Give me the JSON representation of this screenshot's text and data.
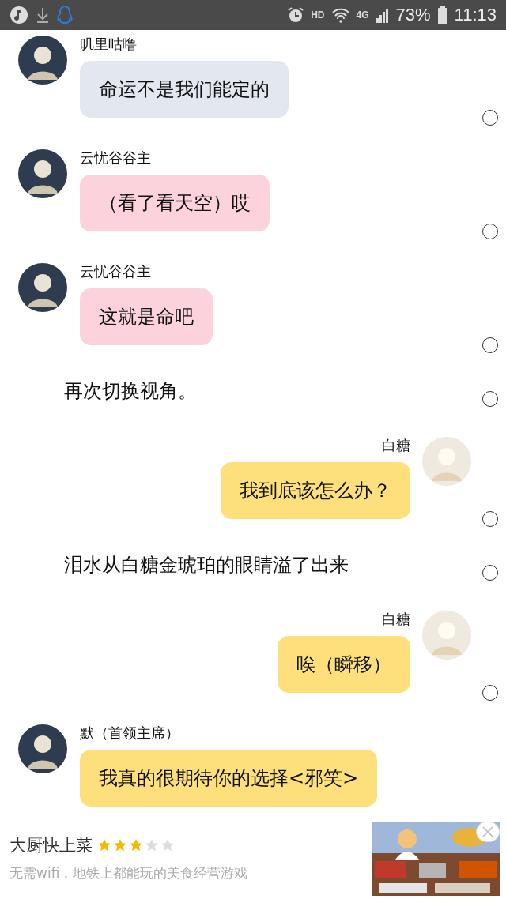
{
  "status_bar": {
    "network": "4G",
    "hd": "HD",
    "battery": "73%",
    "time": "11:13"
  },
  "messages": [
    {
      "kind": "left",
      "sender": "叽里咕噜",
      "text": "命运不是我们能定的",
      "color": "#e3e8f0",
      "selected": false
    },
    {
      "kind": "left",
      "sender": "云忧谷谷主",
      "text": "（看了看天空）哎",
      "color": "#fcd3dc",
      "selected": false
    },
    {
      "kind": "left",
      "sender": "云忧谷谷主",
      "text": "这就是命吧",
      "color": "#fcd3dc",
      "selected": false
    },
    {
      "kind": "narration",
      "text": "再次切换视角。",
      "selected": false
    },
    {
      "kind": "right",
      "sender": "白糖",
      "text": "我到底该怎么办？",
      "color": "#fde07c",
      "selected": false
    },
    {
      "kind": "narration",
      "text": "泪水从白糖金琥珀的眼睛溢了出来",
      "selected": false
    },
    {
      "kind": "right",
      "sender": "白糖",
      "text": "唉（瞬移）",
      "color": "#fde07c",
      "selected": false
    },
    {
      "kind": "left",
      "sender": "默（首领主席）",
      "text": "我真的很期待你的选择<邪笑>",
      "color": "#fde07c"
    }
  ],
  "ad": {
    "title": "大厨快上菜",
    "stars": 3,
    "subtitle": "无需wifi，地铁上都能玩的美食经营游戏"
  }
}
